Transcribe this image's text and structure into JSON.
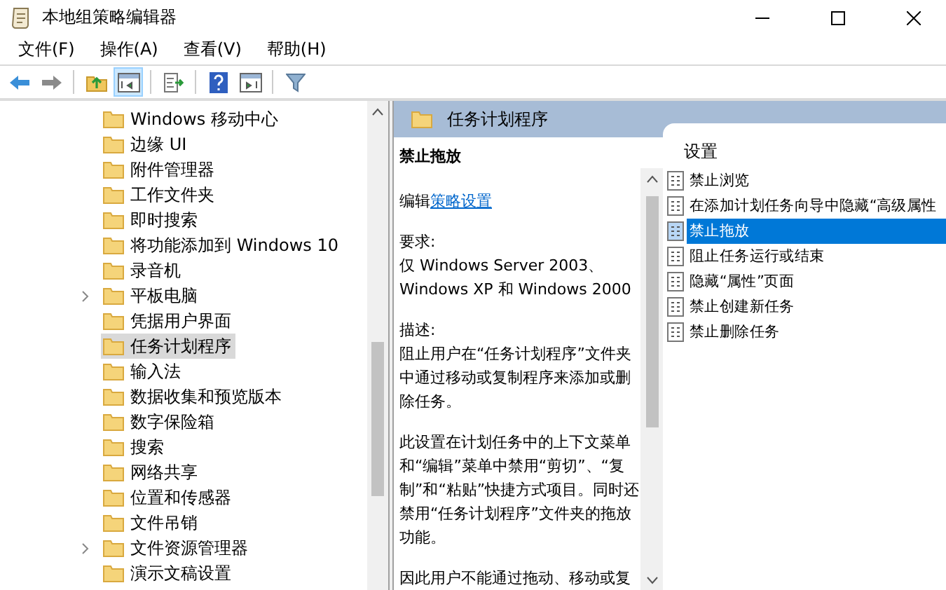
{
  "window": {
    "title": "本地组策略编辑器"
  },
  "menu": [
    "文件(F)",
    "操作(A)",
    "查看(V)",
    "帮助(H)"
  ],
  "toolbar": [
    {
      "kind": "back",
      "pressed": false
    },
    {
      "kind": "forward",
      "pressed": false
    },
    {
      "kind": "sep"
    },
    {
      "kind": "up",
      "pressed": false
    },
    {
      "kind": "tree",
      "pressed": true
    },
    {
      "kind": "sep"
    },
    {
      "kind": "export",
      "pressed": false
    },
    {
      "kind": "sep"
    },
    {
      "kind": "help",
      "pressed": false
    },
    {
      "kind": "pane",
      "pressed": false
    },
    {
      "kind": "sep"
    },
    {
      "kind": "filter",
      "pressed": false
    }
  ],
  "tree": {
    "items": [
      {
        "label": "Windows 移动中心",
        "has_children": false,
        "selected": false
      },
      {
        "label": "边缘 UI",
        "has_children": false,
        "selected": false
      },
      {
        "label": "附件管理器",
        "has_children": false,
        "selected": false
      },
      {
        "label": "工作文件夹",
        "has_children": false,
        "selected": false
      },
      {
        "label": "即时搜索",
        "has_children": false,
        "selected": false
      },
      {
        "label": "将功能添加到 Windows 10",
        "has_children": false,
        "selected": false
      },
      {
        "label": "录音机",
        "has_children": false,
        "selected": false
      },
      {
        "label": "平板电脑",
        "has_children": true,
        "selected": false
      },
      {
        "label": "凭据用户界面",
        "has_children": false,
        "selected": false
      },
      {
        "label": "任务计划程序",
        "has_children": false,
        "selected": true
      },
      {
        "label": "输入法",
        "has_children": false,
        "selected": false
      },
      {
        "label": "数据收集和预览版本",
        "has_children": false,
        "selected": false
      },
      {
        "label": "数字保险箱",
        "has_children": false,
        "selected": false
      },
      {
        "label": "搜索",
        "has_children": false,
        "selected": false
      },
      {
        "label": "网络共享",
        "has_children": false,
        "selected": false
      },
      {
        "label": "位置和传感器",
        "has_children": false,
        "selected": false
      },
      {
        "label": "文件吊销",
        "has_children": false,
        "selected": false
      },
      {
        "label": "文件资源管理器",
        "has_children": true,
        "selected": false
      },
      {
        "label": "演示文稿设置",
        "has_children": false,
        "selected": false
      }
    ]
  },
  "header": {
    "title": "任务计划程序"
  },
  "description": {
    "title": "禁止拖放",
    "edit_prefix": "编辑",
    "edit_link": "策略设置",
    "requirements_label": "要求:",
    "requirements": "仅 Windows Server 2003、Windows XP 和 Windows 2000",
    "description_label": "描述:",
    "paragraphs": [
      "阻止用户在“任务计划程序”文件夹中通过移动或复制程序来添加或删除任务。",
      "此设置在计划任务中的上下文菜单和“编辑”菜单中禁用“剪切”、“复制”和“粘贴”快捷方式项目。同时还禁用“任务计划程序”文件夹的拖放功能。",
      "因此用户不能通过拖动、移动或复"
    ]
  },
  "settings": {
    "column": "设置",
    "items": [
      {
        "label": "禁止浏览",
        "selected": false
      },
      {
        "label": "在添加计划任务向导中隐藏“高级属性",
        "selected": false
      },
      {
        "label": "禁止拖放",
        "selected": true
      },
      {
        "label": "阻止任务运行或结束",
        "selected": false
      },
      {
        "label": "隐藏“属性”页面",
        "selected": false
      },
      {
        "label": "禁止创建新任务",
        "selected": false
      },
      {
        "label": "禁止删除任务",
        "selected": false
      }
    ]
  }
}
